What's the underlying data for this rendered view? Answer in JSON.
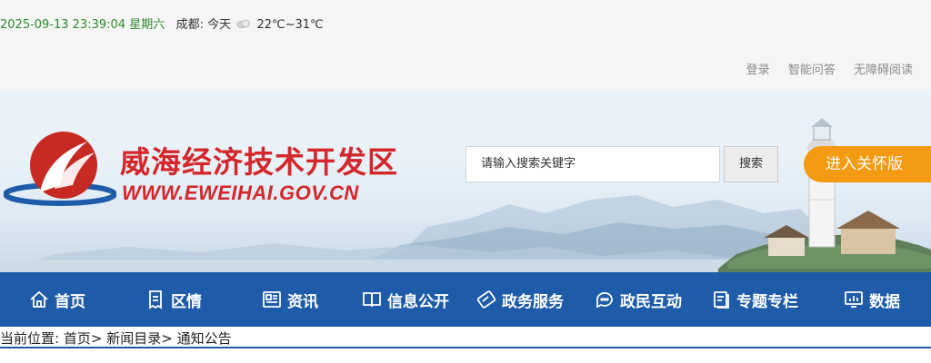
{
  "topbar": {
    "datetime": "2025-09-13 23:39:04",
    "weekday": "星期六",
    "city_label": "成都:",
    "today_label": "今天",
    "temperature": "22℃~31℃",
    "weather_icon": "cloudy-icon",
    "links": [
      "登录",
      "智能问答",
      "无障碍阅读"
    ]
  },
  "header": {
    "site_title": "威海经济技术开发区",
    "site_url": "WWW.EWEIHAI.GOV.CN",
    "logo_icon": "ewei-emblem",
    "search_placeholder": "请输入搜索关键字",
    "search_button": "搜索",
    "care_button": "进入关怀版"
  },
  "nav": {
    "items": [
      {
        "label": "首页",
        "icon": "home-icon"
      },
      {
        "label": "区情",
        "icon": "document-icon"
      },
      {
        "label": "资讯",
        "icon": "news-icon"
      },
      {
        "label": "信息公开",
        "icon": "book-icon"
      },
      {
        "label": "政务服务",
        "icon": "handshake-icon"
      },
      {
        "label": "政民互动",
        "icon": "chat-icon"
      },
      {
        "label": "专题专栏",
        "icon": "topic-icon"
      },
      {
        "label": "数据",
        "icon": "chart-icon"
      }
    ]
  },
  "breadcrumb": {
    "prefix": "当前位置:",
    "items": [
      "首页>",
      "新闻目录>",
      "通知公告"
    ]
  },
  "colors": {
    "brand_red": "#d3272b",
    "nav_blue": "#1e5ba8",
    "care_orange": "#f39a12",
    "date_green": "#2e8b2e"
  }
}
